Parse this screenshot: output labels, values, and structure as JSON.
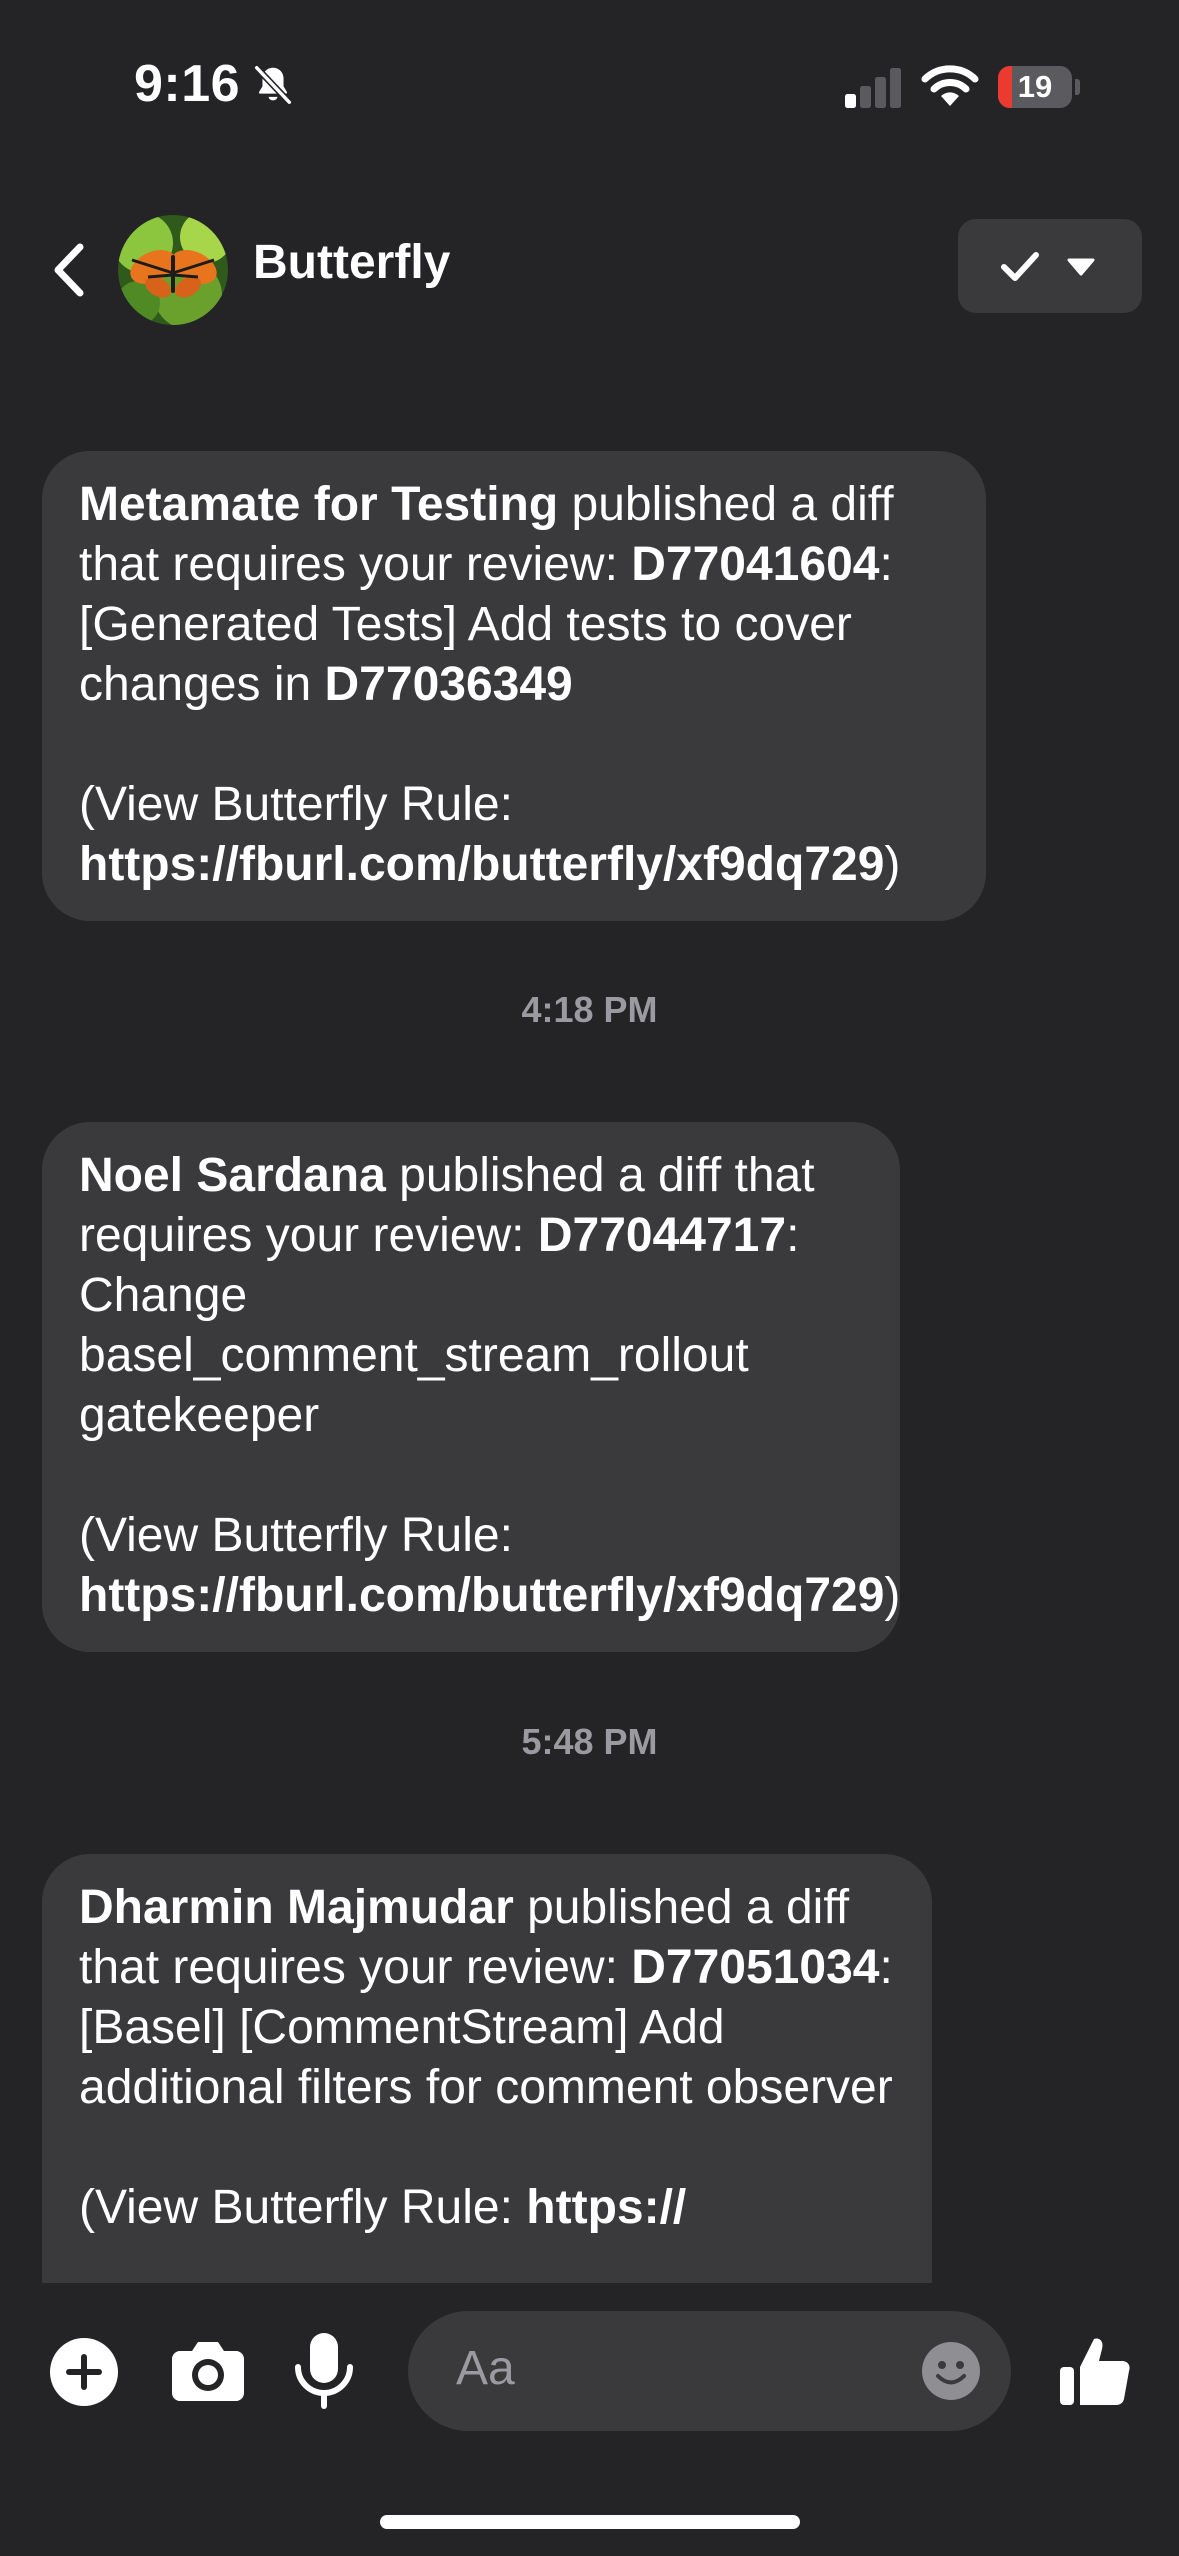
{
  "status_bar": {
    "time": "9:16",
    "battery_level": "19",
    "battery_fraction": 0.19,
    "icons": [
      "bell-slash-icon",
      "cellular-signal-icon",
      "wifi-icon",
      "battery-icon"
    ]
  },
  "header": {
    "title": "Butterfly",
    "avatar": "butterfly-avatar",
    "back_icon": "chevron-left-icon",
    "status_button_icons": [
      "checkmark-icon",
      "caret-down-icon"
    ]
  },
  "messages": [
    {
      "author": "Metamate for Testing",
      "pre_diff": " published a diff that requires your review: ",
      "diff_id": "D77041604",
      "diff_title": ": [Generated Tests] Add tests to cover changes in ",
      "ref_diff": "D77036349",
      "rule_prefix": "(View Butterfly Rule: ",
      "rule_link": "https://fburl.com/butterfly/xf9dq729",
      "rule_suffix": ")"
    },
    {
      "author": "Noel Sardana",
      "pre_diff": " published a diff that requires your review: ",
      "diff_id": "D77044717",
      "diff_title": ": Change basel_comment_stream_rollout gatekeeper",
      "rule_prefix": "(View Butterfly Rule: ",
      "rule_link": "https://fburl.com/butterfly/xf9dq729",
      "rule_suffix": ")"
    },
    {
      "author": "Dharmin Majmudar",
      "pre_diff": " published a diff that requires your review: ",
      "diff_id": "D77051034",
      "diff_title": ": [Basel] [CommentStream] Add additional filters for comment observer",
      "rule_prefix": "(View Butterfly Rule: ",
      "rule_link": "https://",
      "rule_suffix": ""
    }
  ],
  "timestamps": [
    "4:18 PM",
    "5:48 PM"
  ],
  "composer": {
    "placeholder": "Aa",
    "icons": [
      "plus-circle-icon",
      "camera-icon",
      "microphone-icon",
      "emoji-icon",
      "thumbs-up-icon"
    ]
  },
  "colors": {
    "background": "#242427",
    "bubble": "#3a3a3d",
    "timestamp": "#9a9aa0",
    "battery_low": "#eb3b30"
  }
}
